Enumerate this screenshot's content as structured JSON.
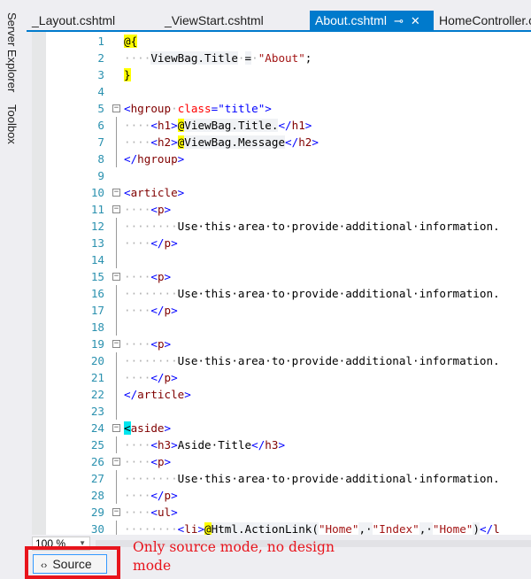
{
  "side_panel": {
    "server_explorer": "Server Explorer",
    "toolbox": "Toolbox"
  },
  "tabs": [
    {
      "label": "_Layout.cshtml"
    },
    {
      "label": "_ViewStart.cshtml"
    },
    {
      "label": "About.cshtml",
      "active": true
    },
    {
      "label": "HomeController.cs"
    }
  ],
  "tab_icons": {
    "pin": "⊸",
    "close": "✕"
  },
  "lines": [
    [
      [
        "@",
        "rz"
      ],
      [
        "{",
        "rz"
      ]
    ],
    [
      [
        "····",
        "d"
      ],
      [
        "ViewBag.Title",
        "rb"
      ],
      [
        "·",
        "d"
      ],
      [
        "=",
        "rb"
      ],
      [
        "·",
        "d"
      ],
      [
        "\"About\"",
        "s"
      ],
      [
        ";",
        "t"
      ]
    ],
    [
      [
        "}",
        "rz"
      ]
    ],
    [],
    [
      [
        "<",
        "b"
      ],
      [
        "hgroup",
        "m"
      ],
      [
        "·",
        "d"
      ],
      [
        "class",
        "r"
      ],
      [
        "=",
        "b"
      ],
      [
        "\"title\"",
        "v"
      ],
      [
        ">",
        "b"
      ]
    ],
    [
      [
        "····",
        "d"
      ],
      [
        "<",
        "b"
      ],
      [
        "h1",
        "m"
      ],
      [
        ">",
        "b"
      ],
      [
        "@",
        "rz"
      ],
      [
        "ViewBag.Title.",
        "rb"
      ],
      [
        "</",
        "b"
      ],
      [
        "h1",
        "m"
      ],
      [
        ">",
        "b"
      ]
    ],
    [
      [
        "····",
        "d"
      ],
      [
        "<",
        "b"
      ],
      [
        "h2",
        "m"
      ],
      [
        ">",
        "b"
      ],
      [
        "@",
        "rz"
      ],
      [
        "ViewBag.Message",
        "rb"
      ],
      [
        "</",
        "b"
      ],
      [
        "h2",
        "m"
      ],
      [
        ">",
        "b"
      ]
    ],
    [
      [
        "</",
        "b"
      ],
      [
        "hgroup",
        "m"
      ],
      [
        ">",
        "b"
      ]
    ],
    [],
    [
      [
        "<",
        "b"
      ],
      [
        "article",
        "m"
      ],
      [
        ">",
        "b"
      ]
    ],
    [
      [
        "····",
        "d"
      ],
      [
        "<",
        "b"
      ],
      [
        "p",
        "m"
      ],
      [
        ">",
        "b"
      ]
    ],
    [
      [
        "········",
        "d"
      ],
      [
        "Use·this·area·to·provide·additional·information.",
        "t"
      ]
    ],
    [
      [
        "····",
        "d"
      ],
      [
        "</",
        "b"
      ],
      [
        "p",
        "m"
      ],
      [
        ">",
        "b"
      ]
    ],
    [],
    [
      [
        "····",
        "d"
      ],
      [
        "<",
        "b"
      ],
      [
        "p",
        "m"
      ],
      [
        ">",
        "b"
      ]
    ],
    [
      [
        "········",
        "d"
      ],
      [
        "Use·this·area·to·provide·additional·information.",
        "t"
      ]
    ],
    [
      [
        "····",
        "d"
      ],
      [
        "</",
        "b"
      ],
      [
        "p",
        "m"
      ],
      [
        ">",
        "b"
      ]
    ],
    [],
    [
      [
        "····",
        "d"
      ],
      [
        "<",
        "b"
      ],
      [
        "p",
        "m"
      ],
      [
        ">",
        "b"
      ]
    ],
    [
      [
        "········",
        "d"
      ],
      [
        "Use·this·area·to·provide·additional·information.",
        "t"
      ]
    ],
    [
      [
        "····",
        "d"
      ],
      [
        "</",
        "b"
      ],
      [
        "p",
        "m"
      ],
      [
        ">",
        "b"
      ]
    ],
    [
      [
        "</",
        "b"
      ],
      [
        "article",
        "m"
      ],
      [
        ">",
        "b"
      ]
    ],
    [],
    [
      [
        "<",
        "hl"
      ],
      [
        "aside",
        "m"
      ],
      [
        ">",
        "b"
      ]
    ],
    [
      [
        "····",
        "d"
      ],
      [
        "<",
        "b"
      ],
      [
        "h3",
        "m"
      ],
      [
        ">",
        "b"
      ],
      [
        "Aside·Title",
        "t"
      ],
      [
        "</",
        "b"
      ],
      [
        "h3",
        "m"
      ],
      [
        ">",
        "b"
      ]
    ],
    [
      [
        "····",
        "d"
      ],
      [
        "<",
        "b"
      ],
      [
        "p",
        "m"
      ],
      [
        ">",
        "b"
      ]
    ],
    [
      [
        "········",
        "d"
      ],
      [
        "Use·this·area·to·provide·additional·information.",
        "t"
      ]
    ],
    [
      [
        "····",
        "d"
      ],
      [
        "</",
        "b"
      ],
      [
        "p",
        "m"
      ],
      [
        ">",
        "b"
      ]
    ],
    [
      [
        "····",
        "d"
      ],
      [
        "<",
        "b"
      ],
      [
        "ul",
        "m"
      ],
      [
        ">",
        "b"
      ]
    ],
    [
      [
        "········",
        "d"
      ],
      [
        "<",
        "b"
      ],
      [
        "li",
        "m"
      ],
      [
        ">",
        "b"
      ],
      [
        "@",
        "rz"
      ],
      [
        "Html.ActionLink(",
        "rb"
      ],
      [
        "\"Home\"",
        "s"
      ],
      [
        ",·",
        "rb"
      ],
      [
        "\"Index\"",
        "s"
      ],
      [
        ",·",
        "rb"
      ],
      [
        "\"Home\"",
        "s"
      ],
      [
        ")",
        "rb"
      ],
      [
        "</",
        "b"
      ],
      [
        "l",
        "m"
      ]
    ]
  ],
  "folds": [
    5,
    10,
    11,
    15,
    19,
    24,
    26,
    29
  ],
  "bottom": {
    "zoom": "100 %",
    "source_label": "Source",
    "source_icon": "‹›"
  },
  "annotation": "Only source mode, no design mode"
}
